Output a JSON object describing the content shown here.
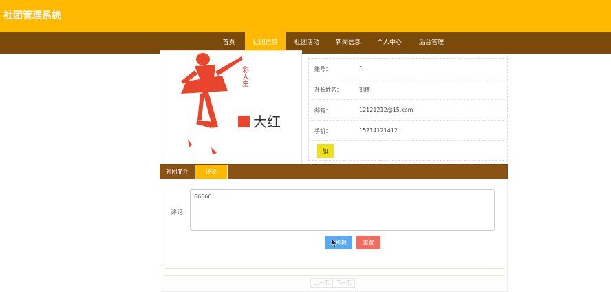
{
  "header": {
    "title": "社团管理系统"
  },
  "nav": {
    "items": [
      {
        "label": "首页",
        "active": false
      },
      {
        "label": "社团信息",
        "active": true
      },
      {
        "label": "社团活动",
        "active": false
      },
      {
        "label": "新闻信息",
        "active": false
      },
      {
        "label": "个人中心",
        "active": false
      },
      {
        "label": "后台管理",
        "active": false
      }
    ]
  },
  "club_image": {
    "caption_big": "大红",
    "caption_small": "彩人生"
  },
  "club_info": {
    "rows": [
      {
        "label": "账号：",
        "value": "1"
      },
      {
        "label": "社长姓名：",
        "value": "刘倩"
      },
      {
        "label": "邮箱：",
        "value": "12121212@15.com"
      },
      {
        "label": "手机：",
        "value": "15214121412"
      }
    ],
    "join_label": "加入"
  },
  "tabs": [
    {
      "label": "社团简介",
      "active": false
    },
    {
      "label": "评论",
      "active": true
    }
  ],
  "comment": {
    "label": "评论",
    "value": "66666",
    "submit_label": "立即提交",
    "reset_label": "重置"
  },
  "pager": {
    "prev_label": "上一页",
    "next_label": "下一页"
  },
  "colors": {
    "primary": "#ffb900",
    "nav": "#7a4a0a",
    "submit": "#5aa9f0",
    "reset": "#f06e60",
    "join": "#f0e01a"
  }
}
